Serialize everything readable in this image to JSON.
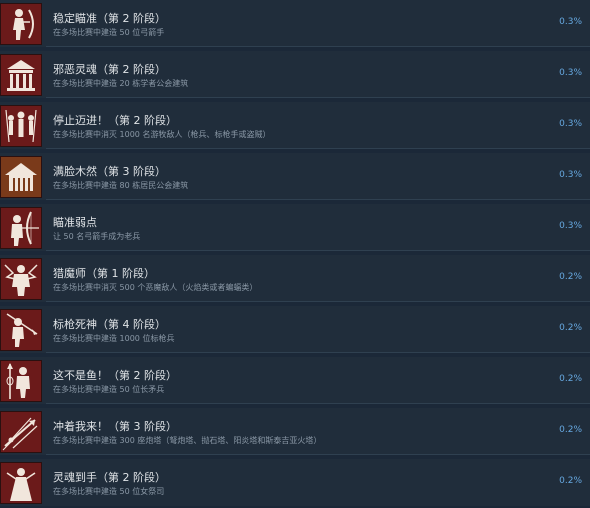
{
  "achievements": [
    {
      "icon": "archer-icon",
      "title": "稳定瞄准（第 2 阶段）",
      "desc": "在多场比赛中建造 50 位弓箭手",
      "percent": "0.3%"
    },
    {
      "icon": "cathedral-icon",
      "title": "邪恶灵魂（第 2 阶段）",
      "desc": "在多场比赛中建造 20 栋学者公会建筑",
      "percent": "0.3%"
    },
    {
      "icon": "warriors-group-icon",
      "title": "停止迈进！（第 2 阶段）",
      "desc": "在多场比赛中消灭 1000 名游牧敌人（枪兵、标枪手或盗贼）",
      "percent": "0.3%"
    },
    {
      "icon": "house-icon",
      "title": "满脸木然（第 3 阶段）",
      "desc": "在多场比赛中建造 80 栋居民公会建筑",
      "percent": "0.3%"
    },
    {
      "icon": "archer-aim-icon",
      "title": "瞄准弱点",
      "desc": "让 50 名弓箭手成为老兵",
      "percent": "0.3%"
    },
    {
      "icon": "demon-hunter-icon",
      "title": "猎魔师（第 1 阶段）",
      "desc": "在多场比赛中消灭 500 个恶魔敌人（火焰类或者蝙蝠类）",
      "percent": "0.2%"
    },
    {
      "icon": "javelin-thrower-icon",
      "title": "标枪死神（第 4 阶段）",
      "desc": "在多场比赛中建造 1000 位标枪兵",
      "percent": "0.2%"
    },
    {
      "icon": "spearman-icon",
      "title": "这不是鱼！（第 2 阶段）",
      "desc": "在多场比赛中建造 50 位长矛兵",
      "percent": "0.2%"
    },
    {
      "icon": "siege-tower-icon",
      "title": "冲着我来！（第 3 阶段）",
      "desc": "在多场比赛中建造 300 座炮塔（弩炮塔、抛石塔、阳炎塔和斯泰吉亚火塔）",
      "percent": "0.2%"
    },
    {
      "icon": "priestess-icon",
      "title": "灵魂到手（第 2 阶段）",
      "desc": "在多场比赛中建造 50 位女祭司",
      "percent": "0.2%"
    }
  ]
}
